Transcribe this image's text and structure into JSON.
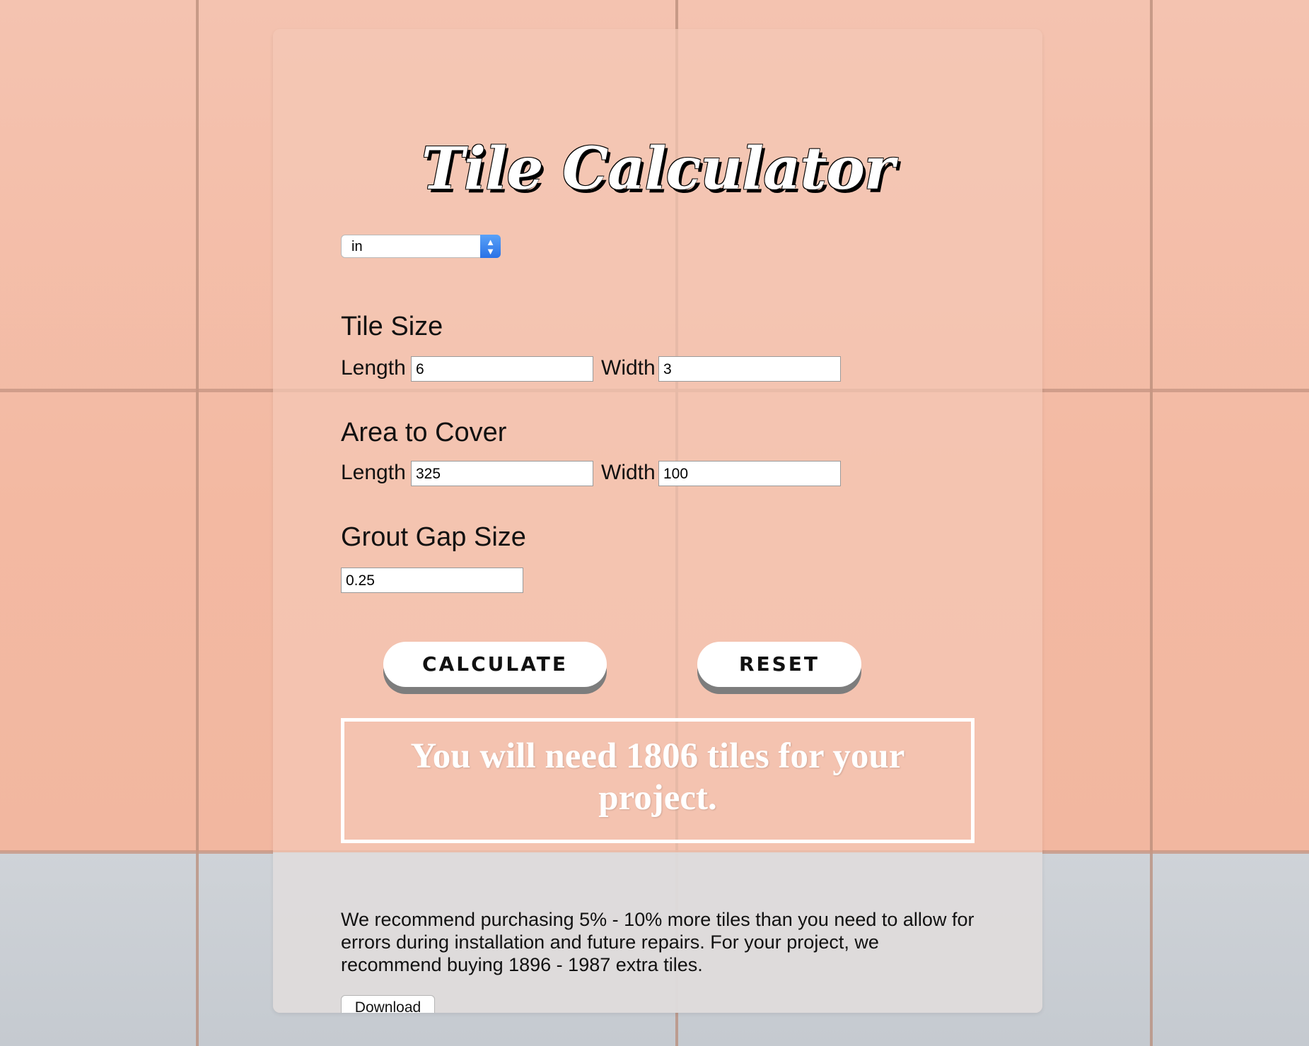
{
  "app": {
    "title": "Tile Calculator"
  },
  "unit_select": {
    "selected": "in",
    "arrow": "⌃⌄"
  },
  "tile_size": {
    "heading": "Tile Size",
    "length_label": "Length",
    "length_value": "6",
    "width_label": "Width",
    "width_value": "3"
  },
  "area": {
    "heading": "Area to Cover",
    "length_label": "Length",
    "length_value": "325",
    "width_label": "Width",
    "width_value": "100"
  },
  "grout": {
    "heading": "Grout Gap Size",
    "value": "0.25"
  },
  "buttons": {
    "calculate": "CALCULATE",
    "reset": "RESET",
    "download": "Download"
  },
  "result": {
    "text": "You will need 1806 tiles for your project."
  },
  "recommendation": {
    "text": "We recommend purchasing 5% - 10% more tiles than you need to allow for errors during installation and future repairs. For your project, we recommend buying 1896 - 1987 extra tiles."
  },
  "colors": {
    "tile_background": "#f4bea8",
    "select_accent": "#2a72e6",
    "button_shadow": "#7d7d7d"
  }
}
